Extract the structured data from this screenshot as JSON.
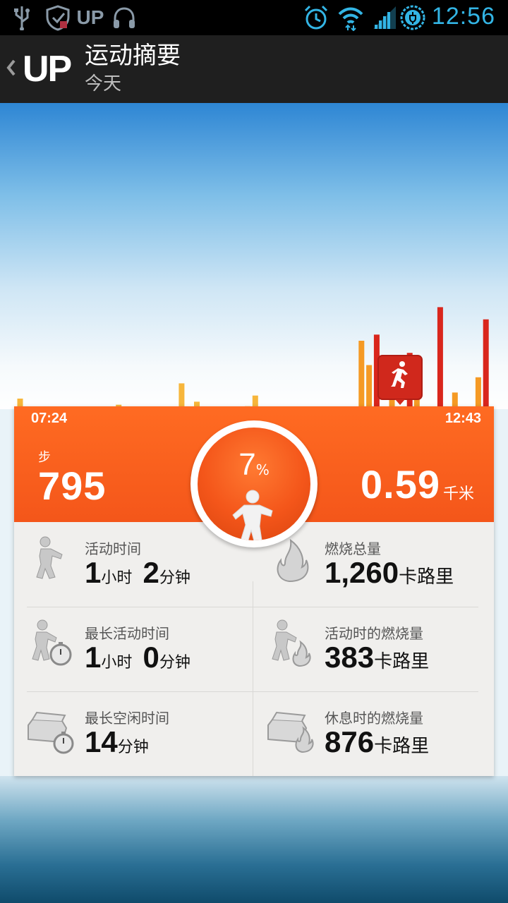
{
  "status_bar": {
    "time": "12:56",
    "left_icons": [
      "usb-icon",
      "security-icon",
      "up-app-icon",
      "headphones-icon"
    ],
    "up_label": "UP",
    "right_icons": [
      "alarm-icon",
      "wifi-icon",
      "signal-icon",
      "battery-charging-icon"
    ]
  },
  "action_bar": {
    "app_name": "UP",
    "title": "运动摘要",
    "subtitle": "今天"
  },
  "chart_data": {
    "type": "bar",
    "x_start": "07:24",
    "x_end": "12:43",
    "bars": [
      {
        "x": 0.034,
        "v": 0.03,
        "c": "#f7b63b"
      },
      {
        "x": 0.228,
        "v": 0.01,
        "c": "#f7b63b"
      },
      {
        "x": 0.352,
        "v": 0.08,
        "c": "#f7b63b"
      },
      {
        "x": 0.382,
        "v": 0.02,
        "c": "#f7b63b"
      },
      {
        "x": 0.482,
        "v": 0.005,
        "c": "#f7b63b"
      },
      {
        "x": 0.497,
        "v": 0.04,
        "c": "#f7b63b"
      },
      {
        "x": 0.706,
        "v": 0.22,
        "c": "#f59a24"
      },
      {
        "x": 0.721,
        "v": 0.14,
        "c": "#f59a24"
      },
      {
        "x": 0.736,
        "v": 0.24,
        "c": "#d9261c"
      },
      {
        "x": 0.766,
        "v": 0.04,
        "c": "#f59a24"
      },
      {
        "x": 0.801,
        "v": 0.18,
        "c": "#d9261c"
      },
      {
        "x": 0.815,
        "v": 0.05,
        "c": "#f59a24"
      },
      {
        "x": 0.861,
        "v": 0.33,
        "c": "#d9261c"
      },
      {
        "x": 0.89,
        "v": 0.05,
        "c": "#f59a24"
      },
      {
        "x": 0.936,
        "v": 0.1,
        "c": "#f59a24"
      },
      {
        "x": 0.951,
        "v": 0.29,
        "c": "#d9261c"
      }
    ]
  },
  "summary": {
    "time_start": "07:24",
    "time_end": "12:43",
    "steps_label": "步",
    "steps": "795",
    "percent": "7",
    "percent_sign": "%",
    "distance": "0.59",
    "distance_unit": "千米"
  },
  "stats": {
    "active_time": {
      "label": "活动时间",
      "hours": "1",
      "h_unit": "小时",
      "minutes": "2",
      "m_unit": "分钟"
    },
    "total_burn": {
      "label": "燃烧总量",
      "value": "1,260",
      "unit": "卡路里"
    },
    "longest_active": {
      "label": "最长活动时间",
      "hours": "1",
      "h_unit": "小时",
      "minutes": "0",
      "m_unit": "分钟"
    },
    "active_burn": {
      "label": "活动时的燃烧量",
      "value": "383",
      "unit": "卡路里"
    },
    "longest_idle": {
      "label": "最长空闲时间",
      "minutes": "14",
      "m_unit": "分钟"
    },
    "rest_burn": {
      "label": "休息时的燃烧量",
      "value": "876",
      "unit": "卡路里"
    }
  },
  "colors": {
    "accent_orange": "#f4561a",
    "status_blue": "#33b5e5",
    "bar_yellow": "#f7b63b",
    "bar_red": "#d9261c"
  }
}
